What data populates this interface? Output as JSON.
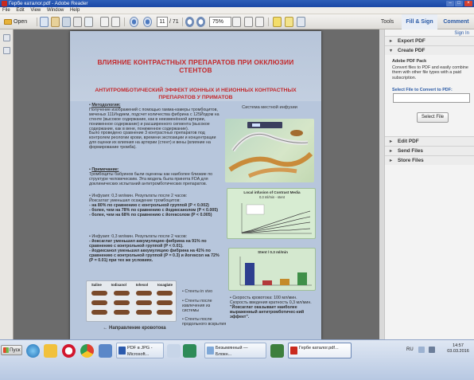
{
  "window": {
    "title": "Гербе каталог.pdf - Adobe Reader"
  },
  "menu": [
    "File",
    "Edit",
    "View",
    "Window",
    "Help"
  ],
  "toolbar": {
    "open_label": "Open",
    "page_current": "11",
    "page_total": "/ 71",
    "zoom": "75%"
  },
  "tabs": {
    "tools": "Tools",
    "fill_sign": "Fill & Sign",
    "comment": "Comment"
  },
  "document": {
    "title": "ВЛИЯНИЕ КОНТРАСТНЫХ ПРЕПАРАТОВ ПРИ ОККЛЮЗИИ СТЕНТОВ",
    "subtitle": "АНТИТРОМБОТИЧЕСКИЙ ЭФФЕКТ ИОННЫХ И НЕИОННЫХ КОНТРАСТНЫХ ПРЕПАРАТОВ У ПРИМАТОВ",
    "method_title": "Методология:",
    "method_text": "Получение изображений с помощью гамма-камеры тромбоцитов, меченых 111Индием, подсчет количества фибрина с 125Йодом на стенте (высокое содержание, как в неизменённой артерии, пониженное содержание) и расширенного сегмента (высокое содержание, как в вене, пониженное содержание).",
    "method_text2": "Было проведено сравнение 3 контрастных препаратов под контролем реологии крови, времени экспозиции и концентрации для оценки их влияния на артерии (стент) и вены (влияние на формирование тромба).",
    "note_title": "Примечание:",
    "note_text": "Тромбоциты бабуинов были оценены как наиболее близкие по структуре человеческим. Эта модель была принята FDA для доклинических испытаний антитромботических препаратов.",
    "result1_lead": "Инфузия: 0,3 мл/мин. Результаты после 2 часов:",
    "result1_sub": "Йоксаглат уменьшил осаждение тромбоцитов:",
    "result1_items": [
      "- на 80% по сравнению с контрольной группой (P < 0.002)",
      "- более, чем на 78% по сравнению с йодиксанолом (P < 0.005)",
      "- более, чем на 68% по сравнению с йогексолом (P < 0.005)"
    ],
    "result2_lead": "Инфузия: 0,3 мл/мин. Результаты после 2 часов:",
    "result2_items": [
      "- йоксаглат уменьшил аккумуляцию фибрина на 91% по сравнению с контрольной группой (P < 0.01).",
      "- йодиксанол уменьшил аккумуляцию фибрина на 41% по сравнению с контрольной группой (P = 0.3) и йогексол на 72% (P = 0.01) при тех же условиях."
    ],
    "fig1_caption": "Система местной инфузии",
    "fig2_title": "Local infusion of Contrast Media",
    "fig2_sub": "0.3 ml/min - stent",
    "fig3_title": "Stent / 0.3 ml/min",
    "legend": [
      "• Стенты in vivo",
      "• Стенты после извлечения из системы",
      "• Стенты после продольного вскрытия"
    ],
    "sample_cols": [
      "Saline",
      "Iodixanol",
      "Iohexol",
      "Ioxaglate"
    ],
    "flow_label": "Направление кровотока",
    "speed_text": "• Скорость кровотока: 100 мл/мин. Скорость введения кратность 0,3 мл/мин.",
    "conclusion": "\"Йоксаглат оказывает наиболее выраженный антитромботичес-кий эффект\"."
  },
  "rightpane": {
    "signin": "Sign In",
    "export_pdf": "Export PDF",
    "create_pdf": "Create PDF",
    "pack_title": "Adobe PDF Pack",
    "pack_desc": "Convert files to PDF and easily combine them with other file types with a paid subscription.",
    "select_label": "Select File to Convert to PDF:",
    "select_button": "Select File",
    "edit_pdf": "Edit PDF",
    "send_files": "Send Files",
    "store_files": "Store Files"
  },
  "taskbar": {
    "start": "Пуск",
    "tasks": [
      {
        "label": "PDF в JPG - Microsoft..."
      },
      {
        "label": "Безымянный — Блокн..."
      },
      {
        "label": "Гербе каталог.pdf..."
      }
    ],
    "lang": "RU",
    "time": "14:57",
    "date": "03.03.2016"
  },
  "colors": {
    "accent": "#2a5aa6",
    "title_red": "#c4282b",
    "page_bg": "#b7c6dc"
  }
}
